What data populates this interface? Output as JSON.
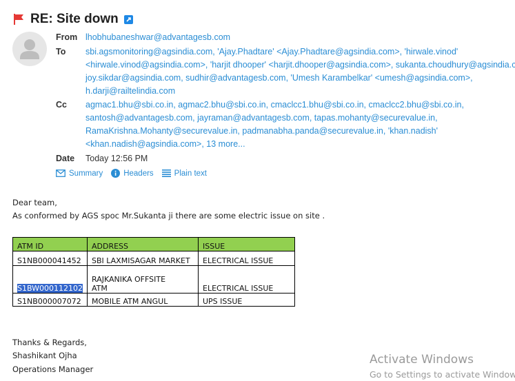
{
  "subject": "RE: Site down",
  "from": {
    "label": "From",
    "value": "lhobhubaneshwar@advantagesb.com"
  },
  "to": {
    "label": "To",
    "lines": [
      "sbi.agsmonitoring@agsindia.com, 'Ajay.Phadtare' <Ajay.Phadtare@agsindia.com>, 'hirwale.vinod'",
      "<hirwale.vinod@agsindia.com>, 'harjit dhooper' <harjit.dhooper@agsindia.com>, sukanta.choudhury@agsindia.c",
      "joy.sikdar@agsindia.com, sudhir@advantagesb.com, 'Umesh Karambelkar' <umesh@agsindia.com>,",
      "h.darji@railtelindia.com"
    ]
  },
  "cc": {
    "label": "Cc",
    "lines": [
      "agmac1.bhu@sbi.co.in, agmac2.bhu@sbi.co.in, cmaclcc1.bhu@sbi.co.in, cmaclcc2.bhu@sbi.co.in,",
      "santosh@advantagesb.com, jayraman@advantagesb.com, tapas.mohanty@securevalue.in,",
      "RamaKrishna.Mohanty@securevalue.in, padmanabha.panda@securevalue.in, 'khan.nadish'",
      "<khan.nadish@agsindia.com>, 13 more..."
    ]
  },
  "date": {
    "label": "Date",
    "value": "Today 12:56 PM"
  },
  "links": {
    "summary": "Summary",
    "headers": "Headers",
    "plain_text": "Plain text"
  },
  "body": {
    "greeting": "Dear team,",
    "line1": "As conformed by AGS spoc Mr.Sukanta ji there are some electric issue on site ."
  },
  "table": {
    "headers": [
      "ATM ID",
      "ADDRESS",
      "ISSUE"
    ],
    "rows": [
      {
        "atm_id": "S1NB000041452",
        "address": [
          "SBI LAXMISAGAR MARKET"
        ],
        "issue": "ELECTRICAL ISSUE"
      },
      {
        "atm_id": "S1BW000112102",
        "address": [
          "RAJKANIKA  OFFSITE",
          "ATM"
        ],
        "issue": "ELECTRICAL ISSUE"
      },
      {
        "atm_id": "S1NB000007072",
        "address": [
          "MOBILE ATM ANGUL"
        ],
        "issue": "UPS ISSUE"
      }
    ]
  },
  "signature": {
    "regards": "Thanks & Regards,",
    "name": "Shashikant Ojha",
    "title": "Operations Manager"
  },
  "watermark": {
    "line1": "Activate Windows",
    "line2": "Go to Settings to activate Windows."
  },
  "colors": {
    "link": "#2a8dd4",
    "table_header": "#92d050",
    "flag": "#e53935",
    "selection": "#3366cc"
  },
  "icons": [
    "flag-icon",
    "external-link-icon",
    "avatar-icon",
    "mail-icon",
    "info-icon",
    "lines-icon"
  ]
}
